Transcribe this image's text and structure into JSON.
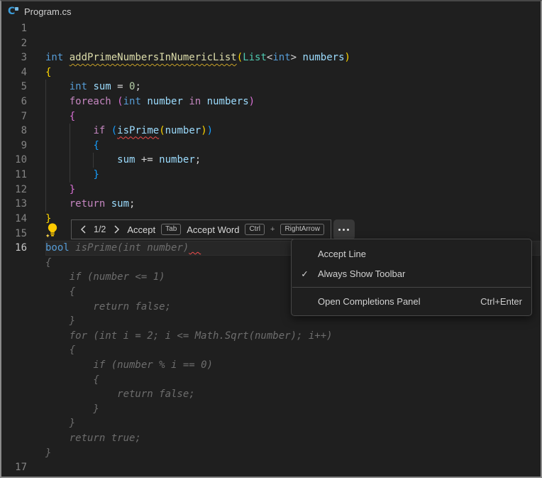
{
  "window": {
    "title": "Program.cs",
    "icon": "csharp-file-icon"
  },
  "syntax_colors": {
    "kwb": "#569CD6",
    "kwp": "#C586C0",
    "fn": "#DCDCAA",
    "typ": "#4EC9B0",
    "var": "#9CDCFE",
    "num": "#B5CEA8",
    "pun": "#D4D4D4",
    "b1": "#FFD700",
    "b2": "#DA70D6",
    "b3": "#179FFF",
    "gho": "#6D6D6D"
  },
  "diagnostic_colors": {
    "warning_squiggle": "#c9a227",
    "error_squiggle": "#f14c4c"
  },
  "toolbar": {
    "counter": "1/2",
    "accept_label": "Accept",
    "accept_key": "Tab",
    "accept_word_label": "Accept Word",
    "accept_word_key_1": "Ctrl",
    "plus": "+",
    "accept_word_key_2": "RightArrow"
  },
  "menu": {
    "check_glyph": "✓",
    "items": [
      {
        "label": "Accept Line",
        "checked": false
      },
      {
        "label": "Always Show Toolbar",
        "checked": true
      },
      {
        "separator": true
      },
      {
        "label": "Open Completions Panel",
        "shortcut": "Ctrl+Enter"
      }
    ]
  },
  "editor": {
    "rows": [
      {
        "n": "1",
        "tokens": [],
        "guides": []
      },
      {
        "n": "2",
        "tokens": [],
        "guides": []
      },
      {
        "n": "3",
        "guides": [],
        "tokens": [
          [
            "int",
            "kwb"
          ],
          [
            " ",
            "pun"
          ],
          [
            "addPrimeNumbersInNumericList",
            "fn wsq"
          ],
          [
            "(",
            "b1"
          ],
          [
            "List",
            "typ"
          ],
          [
            "<",
            "pun"
          ],
          [
            "int",
            "kwb"
          ],
          [
            ">",
            "pun"
          ],
          [
            " ",
            "pun"
          ],
          [
            "numbers",
            "var"
          ],
          [
            ")",
            "b1"
          ]
        ]
      },
      {
        "n": "4",
        "guides": [],
        "tokens": [
          [
            "{",
            "b1"
          ]
        ]
      },
      {
        "n": "5",
        "guides": [
          0
        ],
        "tokens": [
          [
            "    ",
            "pun"
          ],
          [
            "int",
            "kwb"
          ],
          [
            " ",
            "pun"
          ],
          [
            "sum",
            "var"
          ],
          [
            " = ",
            "pun"
          ],
          [
            "0",
            "num"
          ],
          [
            ";",
            "pun"
          ]
        ]
      },
      {
        "n": "6",
        "guides": [
          0
        ],
        "tokens": [
          [
            "    ",
            "pun"
          ],
          [
            "foreach",
            "kwp"
          ],
          [
            " ",
            "pun"
          ],
          [
            "(",
            "b2"
          ],
          [
            "int",
            "kwb"
          ],
          [
            " ",
            "pun"
          ],
          [
            "number",
            "var"
          ],
          [
            " ",
            "pun"
          ],
          [
            "in",
            "kwp"
          ],
          [
            " ",
            "pun"
          ],
          [
            "numbers",
            "var"
          ],
          [
            ")",
            "b2"
          ]
        ]
      },
      {
        "n": "7",
        "guides": [
          0
        ],
        "tokens": [
          [
            "    ",
            "pun"
          ],
          [
            "{",
            "b2"
          ]
        ]
      },
      {
        "n": "8",
        "guides": [
          0,
          4
        ],
        "tokens": [
          [
            "        ",
            "pun"
          ],
          [
            "if",
            "kwp"
          ],
          [
            " ",
            "pun"
          ],
          [
            "(",
            "b3"
          ],
          [
            "isPrime",
            "var esq"
          ],
          [
            "(",
            "b1"
          ],
          [
            "number",
            "var"
          ],
          [
            ")",
            "b1"
          ],
          [
            ")",
            "b3"
          ]
        ]
      },
      {
        "n": "9",
        "guides": [
          0,
          4
        ],
        "tokens": [
          [
            "        ",
            "pun"
          ],
          [
            "{",
            "b3"
          ]
        ]
      },
      {
        "n": "10",
        "guides": [
          0,
          4,
          8
        ],
        "tokens": [
          [
            "            ",
            "pun"
          ],
          [
            "sum",
            "var"
          ],
          [
            " += ",
            "pun"
          ],
          [
            "number",
            "var"
          ],
          [
            ";",
            "pun"
          ]
        ]
      },
      {
        "n": "11",
        "guides": [
          0,
          4
        ],
        "tokens": [
          [
            "        ",
            "pun"
          ],
          [
            "}",
            "b3"
          ]
        ]
      },
      {
        "n": "12",
        "guides": [
          0
        ],
        "tokens": [
          [
            "    ",
            "pun"
          ],
          [
            "}",
            "b2"
          ]
        ]
      },
      {
        "n": "13",
        "guides": [
          0
        ],
        "tokens": [
          [
            "    ",
            "pun"
          ],
          [
            "return",
            "kwp"
          ],
          [
            " ",
            "pun"
          ],
          [
            "sum",
            "var"
          ],
          [
            ";",
            "pun"
          ]
        ]
      },
      {
        "n": "14",
        "guides": [],
        "tokens": [
          [
            "}",
            "b1"
          ]
        ]
      },
      {
        "n": "15",
        "guides": [],
        "tokens": [],
        "lightbulb": true
      },
      {
        "n": "16",
        "guides": [],
        "current": true,
        "end_squiggle": true,
        "tokens": [
          [
            "bool",
            "kwb"
          ],
          [
            " ",
            "pun"
          ],
          [
            "isPrime(int number)",
            "gho"
          ]
        ]
      },
      {
        "n": "",
        "ghost": true,
        "tokens": [
          [
            "{",
            "gho"
          ]
        ]
      },
      {
        "n": "",
        "ghost": true,
        "tokens": [
          [
            "    if (number <= 1)",
            "gho"
          ]
        ]
      },
      {
        "n": "",
        "ghost": true,
        "tokens": [
          [
            "    {",
            "gho"
          ]
        ]
      },
      {
        "n": "",
        "ghost": true,
        "tokens": [
          [
            "        return false;",
            "gho"
          ]
        ]
      },
      {
        "n": "",
        "ghost": true,
        "tokens": [
          [
            "    }",
            "gho"
          ]
        ]
      },
      {
        "n": "",
        "ghost": true,
        "tokens": [
          [
            "    for (int i = 2; i <= Math.Sqrt(number); i++)",
            "gho"
          ]
        ]
      },
      {
        "n": "",
        "ghost": true,
        "tokens": [
          [
            "    {",
            "gho"
          ]
        ]
      },
      {
        "n": "",
        "ghost": true,
        "tokens": [
          [
            "        if (number % i == 0)",
            "gho"
          ]
        ]
      },
      {
        "n": "",
        "ghost": true,
        "tokens": [
          [
            "        {",
            "gho"
          ]
        ]
      },
      {
        "n": "",
        "ghost": true,
        "tokens": [
          [
            "            return false;",
            "gho"
          ]
        ]
      },
      {
        "n": "",
        "ghost": true,
        "tokens": [
          [
            "        }",
            "gho"
          ]
        ]
      },
      {
        "n": "",
        "ghost": true,
        "tokens": [
          [
            "    }",
            "gho"
          ]
        ]
      },
      {
        "n": "",
        "ghost": true,
        "tokens": [
          [
            "    return true;",
            "gho"
          ]
        ]
      },
      {
        "n": "",
        "ghost": true,
        "tokens": [
          [
            "}",
            "gho"
          ]
        ]
      },
      {
        "n": "17",
        "tokens": [],
        "guides": []
      }
    ]
  }
}
